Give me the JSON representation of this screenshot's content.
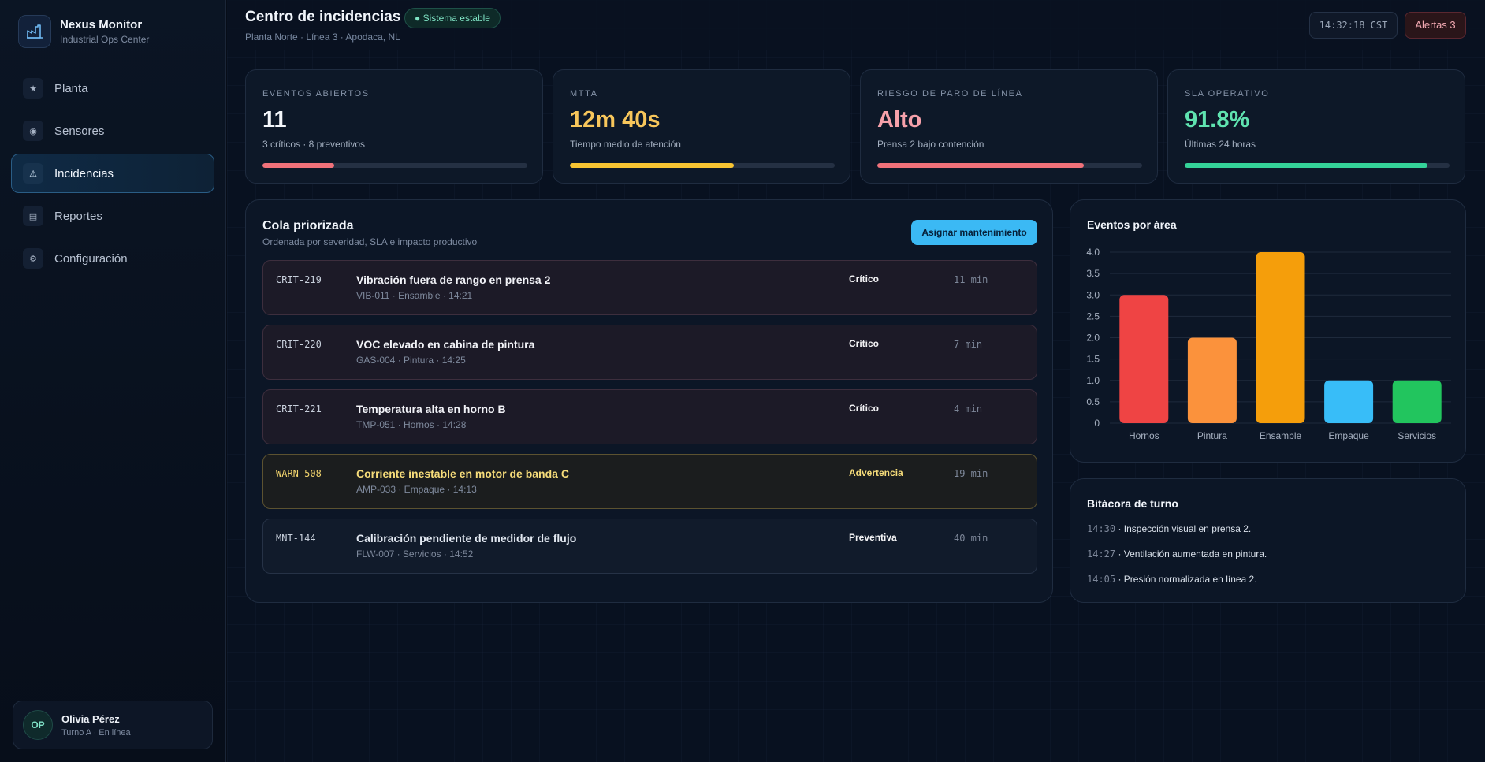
{
  "brand": {
    "name": "Nexus Monitor",
    "subtitle": "Industrial Ops Center"
  },
  "sidebar": {
    "items": [
      {
        "label": "Planta",
        "icon": "star-icon",
        "glyph": "★",
        "active": false
      },
      {
        "label": "Sensores",
        "icon": "sensor-icon",
        "glyph": "◉",
        "active": false
      },
      {
        "label": "Incidencias",
        "icon": "warning-icon",
        "glyph": "⚠",
        "active": true
      },
      {
        "label": "Reportes",
        "icon": "report-icon",
        "glyph": "▤",
        "active": false
      },
      {
        "label": "Configuración",
        "icon": "gear-icon",
        "glyph": "⚙",
        "active": false
      }
    ]
  },
  "user": {
    "initials": "OP",
    "name": "Olivia Pérez",
    "status": "Turno A · En línea"
  },
  "header": {
    "title": "Centro de incidencias",
    "status": "● Sistema estable",
    "breadcrumb": "Planta Norte · Línea 3 · Apodaca, NL",
    "clock": "14:32:18 CST",
    "alerts": "Alertas 3"
  },
  "kpis": [
    {
      "label": "EVENTOS ABIERTOS",
      "value": "11",
      "sub": "3 críticos · 8 preventivos",
      "progress": 0.27,
      "color": "#f0717a",
      "valueColor": "#f4f7fb"
    },
    {
      "label": "MTTA",
      "value": "12m 40s",
      "sub": "Tiempo medio de atención",
      "progress": 0.62,
      "color": "#f7c432",
      "valueColor": "#f7c65b"
    },
    {
      "label": "RIESGO DE PARO DE LÍNEA",
      "value": "Alto",
      "sub": "Prensa 2 bajo contención",
      "progress": 0.78,
      "color": "#f0717a",
      "valueColor": "#f6a1ab"
    },
    {
      "label": "SLA OPERATIVO",
      "value": "91.8%",
      "sub": "Últimas 24 horas",
      "progress": 0.918,
      "color": "#34d399",
      "valueColor": "#5fe3b0"
    }
  ],
  "queue": {
    "title": "Cola priorizada",
    "subtitle": "Ordenada por severidad, SLA e impacto productivo",
    "assign_label": "Asignar mantenimiento",
    "items": [
      {
        "code": "CRIT-219",
        "title": "Vibración fuera de rango en prensa 2",
        "meta": "VIB-011 · Ensamble · 14:21",
        "severity": "Crítico",
        "age": "11 min",
        "kind": "crit"
      },
      {
        "code": "CRIT-220",
        "title": "VOC elevado en cabina de pintura",
        "meta": "GAS-004 · Pintura · 14:25",
        "severity": "Crítico",
        "age": "7 min",
        "kind": "crit"
      },
      {
        "code": "CRIT-221",
        "title": "Temperatura alta en horno B",
        "meta": "TMP-051 · Hornos · 14:28",
        "severity": "Crítico",
        "age": "4 min",
        "kind": "crit"
      },
      {
        "code": "WARN-508",
        "title": "Corriente inestable en motor de banda C",
        "meta": "AMP-033 · Empaque · 14:13",
        "severity": "Advertencia",
        "age": "19 min",
        "kind": "warn"
      },
      {
        "code": "MNT-144",
        "title": "Calibración pendiente de medidor de flujo",
        "meta": "FLW-007 · Servicios · 14:52",
        "severity": "Preventiva",
        "age": "40 min",
        "kind": "prev"
      }
    ]
  },
  "chart_data": {
    "type": "bar",
    "title": "Eventos por área",
    "categories": [
      "Hornos",
      "Pintura",
      "Ensamble",
      "Empaque",
      "Servicios"
    ],
    "values": [
      3,
      2,
      4,
      1,
      1
    ],
    "colors": [
      "#ef4444",
      "#fb923c",
      "#f59e0b",
      "#38bdf8",
      "#22c55e"
    ],
    "ylim": [
      0,
      4
    ],
    "yticks": [
      "0",
      "0.5",
      "1.0",
      "1.5",
      "2.0",
      "2.5",
      "3.0",
      "3.5",
      "4.0"
    ],
    "xlabel": "",
    "ylabel": "",
    "grid": true
  },
  "log": {
    "title": "Bitácora de turno",
    "entries": [
      {
        "time": "14:30",
        "text": " · Inspección visual en prensa 2."
      },
      {
        "time": "14:27",
        "text": " · Ventilación aumentada en pintura."
      },
      {
        "time": "14:05",
        "text": " · Presión normalizada en línea 2."
      }
    ]
  }
}
